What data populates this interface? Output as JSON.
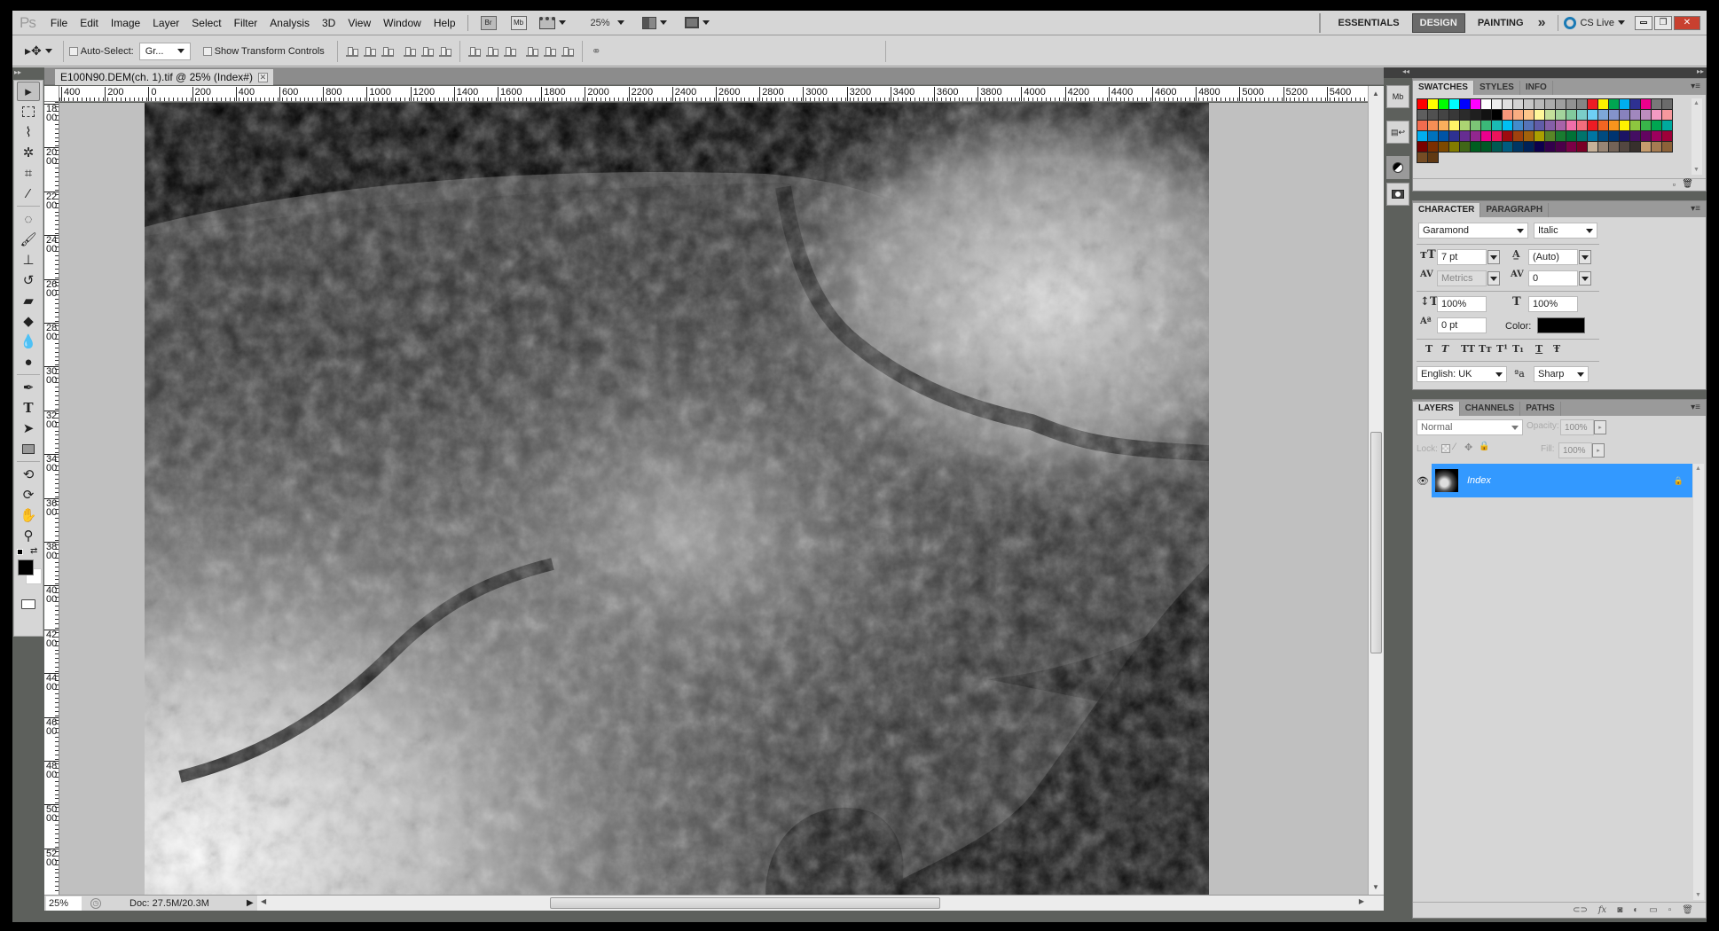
{
  "menubar": {
    "logo": "Ps",
    "items": [
      "File",
      "Edit",
      "Image",
      "Layer",
      "Select",
      "Filter",
      "Analysis",
      "3D",
      "View",
      "Window",
      "Help"
    ],
    "bridge_btn": "Br",
    "minibridge_btn": "Mb",
    "zoom_level": "25%",
    "workspaces": [
      "ESSENTIALS",
      "DESIGN",
      "PAINTING"
    ],
    "active_workspace": "DESIGN",
    "more_workspaces": "»",
    "cs_live": "CS Live",
    "window_controls": [
      "minimize",
      "restore",
      "close"
    ]
  },
  "options": {
    "auto_select_label": "Auto-Select:",
    "auto_select_checked": false,
    "auto_select_target": "Gr...",
    "show_transform_label": "Show Transform Controls",
    "show_transform_checked": false
  },
  "document": {
    "tab_title": "E100N90.DEM(ch. 1).tif @ 25% (Index#)",
    "ruler_top": [
      "400",
      "200",
      "0",
      "200",
      "400",
      "600",
      "800",
      "1000",
      "1200",
      "1400",
      "1600",
      "1800",
      "2000",
      "2200",
      "2400",
      "2600",
      "2800",
      "3000",
      "3200",
      "3400",
      "3600",
      "3800",
      "4000",
      "4200",
      "4400",
      "4600",
      "4800",
      "5000",
      "5200",
      "5400"
    ],
    "ruler_left": [
      "1800",
      "2000",
      "2200",
      "2400",
      "2600",
      "2800",
      "3000",
      "3200",
      "3400",
      "3600",
      "3800",
      "4000",
      "4200",
      "4400",
      "4600",
      "4800",
      "5000",
      "5200"
    ],
    "image_description": "grayscale digital elevation model terrain"
  },
  "status": {
    "zoom": "25%",
    "doc_size": "Doc: 27.5M/20.3M"
  },
  "tools": [
    "move",
    "rectangular-marquee",
    "lasso",
    "magic-wand",
    "crop",
    "eyedropper",
    "spot-healing",
    "brush",
    "clone-stamp",
    "history-brush",
    "eraser",
    "paint-bucket",
    "blur",
    "dodge",
    "pen",
    "type",
    "path-selection",
    "rectangle",
    "3d-rotate",
    "3d-orbit",
    "hand",
    "zoom"
  ],
  "dock": [
    "mini-bridge",
    "history",
    "adjustments",
    "masks"
  ],
  "swatches_panel": {
    "tabs": [
      "SWATCHES",
      "STYLES",
      "INFO"
    ],
    "active": "SWATCHES",
    "colors": [
      "#ff0000",
      "#ffff00",
      "#00ff00",
      "#00ffff",
      "#0000ff",
      "#ff00ff",
      "#ffffff",
      "#ececec",
      "#e0e0e0",
      "#d3d3d3",
      "#c6c6c6",
      "#b9b9b9",
      "#acacac",
      "#9f9f9f",
      "#929292",
      "#858585",
      "#ec1c24",
      "#fff200",
      "#00a651",
      "#00aeef",
      "#2e3192",
      "#ec008c",
      "#787878",
      "#6b6b6b",
      "#5e5e5e",
      "#505050",
      "#444444",
      "#383838",
      "#2b2b2b",
      "#1f1f1f",
      "#121212",
      "#000000",
      "#f7977a",
      "#f9ad81",
      "#fdc68a",
      "#fff79a",
      "#c4df9b",
      "#a3d39c",
      "#82ca9d",
      "#7bcdc8",
      "#6ecff6",
      "#7ea7d8",
      "#8493ca",
      "#8882be",
      "#a187be",
      "#bc8dbf",
      "#f49ac2",
      "#f6989d",
      "#f26c4f",
      "#f68e55",
      "#fbaf5c",
      "#fff467",
      "#acd372",
      "#7cc576",
      "#3bb878",
      "#1abbb4",
      "#00bff3",
      "#438ccb",
      "#5574b9",
      "#605ca8",
      "#855fa8",
      "#a763a8",
      "#f06ea9",
      "#f26d7d",
      "#ed1c24",
      "#f26522",
      "#f7941d",
      "#fff200",
      "#8dc63f",
      "#39b54a",
      "#00a651",
      "#00a99d",
      "#00aeef",
      "#0072bc",
      "#0054a6",
      "#2e3192",
      "#662d91",
      "#92278f",
      "#ec008c",
      "#ed145b",
      "#9e0b0f",
      "#a0410d",
      "#a3620a",
      "#aba000",
      "#598527",
      "#197b30",
      "#007236",
      "#00746b",
      "#0076a3",
      "#004b80",
      "#003471",
      "#1b1464",
      "#440e62",
      "#630460",
      "#9e005d",
      "#9e0039",
      "#790000",
      "#7b2e00",
      "#7d4900",
      "#827b00",
      "#406618",
      "#005e20",
      "#005826",
      "#005952",
      "#005b7f",
      "#003663",
      "#002157",
      "#0d004c",
      "#32004b",
      "#4b0049",
      "#7b0046",
      "#7a0026",
      "#c7b299",
      "#998675",
      "#736357",
      "#534741",
      "#37302d",
      "#c69c6d",
      "#a67c52",
      "#8c6239",
      "#754c24",
      "#603913"
    ]
  },
  "character_panel": {
    "tabs": [
      "CHARACTER",
      "PARAGRAPH"
    ],
    "active": "CHARACTER",
    "font_family": "Garamond",
    "font_style": "Italic",
    "font_size": "7 pt",
    "leading": "(Auto)",
    "kerning": "Metrics",
    "tracking": "0",
    "vertical_scale": "100%",
    "horizontal_scale": "100%",
    "baseline_shift": "0 pt",
    "color_label": "Color:",
    "text_color": "#000000",
    "style_buttons": [
      "T",
      "T",
      "TT",
      "Tт",
      "T¹",
      "T₁",
      "T",
      "Ŧ"
    ],
    "language": "English: UK",
    "antialias_label": "ªa",
    "antialias": "Sharp"
  },
  "layers_panel": {
    "tabs": [
      "LAYERS",
      "CHANNELS",
      "PATHS"
    ],
    "active": "LAYERS",
    "blend_mode": "Normal",
    "opacity_label": "Opacity:",
    "opacity": "100%",
    "lock_label": "Lock:",
    "fill_label": "Fill:",
    "fill": "100%",
    "layers": [
      {
        "name": "Index",
        "visible": true,
        "locked": true,
        "selected": true
      }
    ],
    "footer_icons": [
      "link-layers",
      "layer-style",
      "layer-mask",
      "adjustment-layer",
      "new-group",
      "new-layer",
      "delete-layer"
    ]
  },
  "colors": {
    "accent_selection": "#3399ff",
    "foreground": "#000000",
    "background": "#ffffff"
  }
}
